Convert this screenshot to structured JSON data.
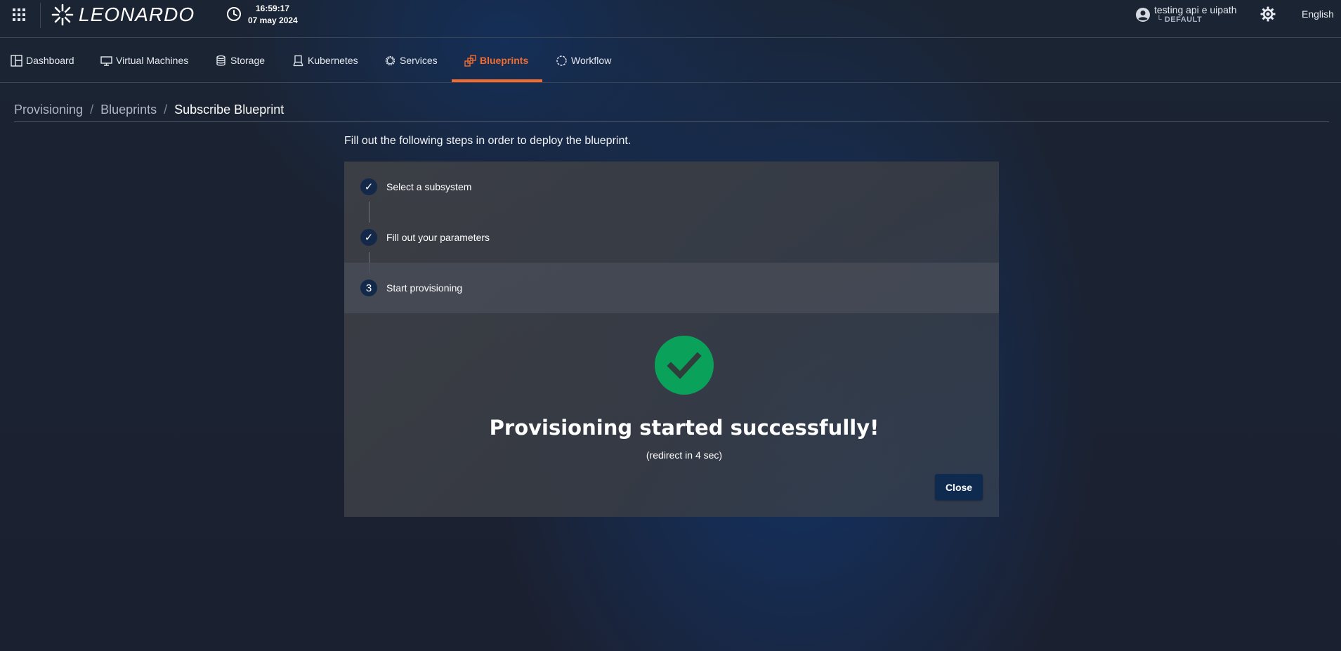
{
  "header": {
    "logo_text": "LEONARDO",
    "time": "16:59:17",
    "date": "07 may 2024",
    "user_name": "testing api e uipath",
    "user_tenant": "└ DEFAULT",
    "language": "English"
  },
  "nav": {
    "items": [
      {
        "label": "Dashboard",
        "icon": "dashboard-icon"
      },
      {
        "label": "Virtual Machines",
        "icon": "monitor-icon"
      },
      {
        "label": "Storage",
        "icon": "database-icon"
      },
      {
        "label": "Kubernetes",
        "icon": "kubernetes-icon"
      },
      {
        "label": "Services",
        "icon": "gear-icon"
      },
      {
        "label": "Blueprints",
        "icon": "blueprint-icon",
        "active": true
      },
      {
        "label": "Workflow",
        "icon": "workflow-icon"
      }
    ],
    "accent_color": "#f26b2f"
  },
  "breadcrumb": {
    "items": [
      "Provisioning",
      "Blueprints"
    ],
    "separator": "/",
    "current": "Subscribe Blueprint"
  },
  "intro": "Fill out the following steps in order to deploy the blueprint.",
  "stepper": {
    "steps": [
      {
        "marker": "✓",
        "label": "Select a subsystem",
        "state": "completed"
      },
      {
        "marker": "✓",
        "label": "Fill out your parameters",
        "state": "completed"
      },
      {
        "marker": "3",
        "label": "Start provisioning",
        "state": "active"
      }
    ]
  },
  "result": {
    "title": "Provisioning started successfully!",
    "subtitle": "(redirect in 4 sec)",
    "icon": "success-check-icon",
    "success_color": "#0aa15a",
    "close_label": "Close"
  }
}
